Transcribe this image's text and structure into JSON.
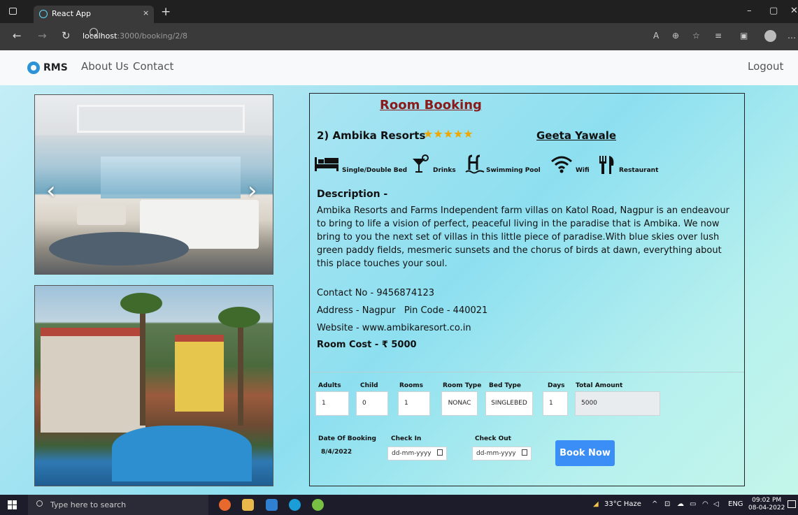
{
  "browser": {
    "tab_title": "React App",
    "tab_close": "×",
    "new_tab": "+",
    "url_host": "localhost",
    "url_path": ":3000/booking/2/8",
    "window_controls": [
      "–",
      "▢",
      "✕"
    ]
  },
  "navbar": {
    "brand": "RMS",
    "links": [
      "About Us",
      "Contact"
    ],
    "logout": "Logout"
  },
  "carousel": {
    "prev_icon": "‹",
    "next_icon": "›"
  },
  "booking": {
    "title": "Room Booking",
    "hotel_name": "2) Ambika Resorts",
    "stars": "★★★★★",
    "rating": 5,
    "owner": "Geeta Yawale",
    "amenities": [
      {
        "label": "Single/Double Bed",
        "icon": "bed-icon"
      },
      {
        "label": "Drinks",
        "icon": "drinks-icon"
      },
      {
        "label": "Swimming Pool",
        "icon": "swimming-pool-icon"
      },
      {
        "label": "Wifi",
        "icon": "wifi-icon"
      },
      {
        "label": "Restaurant",
        "icon": "restaurant-icon"
      }
    ],
    "description_heading": "Description -",
    "description": "Ambika Resorts and Farms Independent farm villas on Katol Road, Nagpur is an endeavour to bring to life a vision of perfect, peaceful living in the paradise that is Ambika. We now bring to you the next set of villas in this little piece of paradise.With blue skies over lush green paddy fields, mesmeric sunsets and the chorus of birds at dawn, everything about this place touches your soul.",
    "contact": "Contact No - 9456874123",
    "address": "Address - Nagpur   Pin Code - 440021",
    "website": "Website - www.ambikaresort.co.in",
    "room_cost": "Room Cost - ₹ 5000"
  },
  "form": {
    "labels": {
      "adults": "Adults",
      "child": "Child",
      "rooms": "Rooms",
      "room_type": "Room Type",
      "bed_type": "Bed Type",
      "days": "Days",
      "total": "Total Amount",
      "date_of_booking": "Date Of Booking",
      "check_in": "Check In",
      "check_out": "Check Out"
    },
    "values": {
      "adults": "1",
      "child": "0",
      "rooms": "1",
      "room_type": "NONAC",
      "bed_type": "SINGLEBED",
      "days": "1",
      "total": "5000",
      "date_of_booking": "8/4/2022",
      "check_in": "dd-mm-yyyy",
      "check_out": "dd-mm-yyyy"
    },
    "book_button": "Book Now"
  },
  "taskbar": {
    "search_placeholder": "Type here to search",
    "weather": "33°C Haze",
    "lang": "ENG",
    "time": "09:02 PM",
    "date": "08-04-2022"
  },
  "colors": {
    "title_red": "#8b1a1a",
    "star": "#f0a800",
    "book_button": "#3a8ef6"
  }
}
